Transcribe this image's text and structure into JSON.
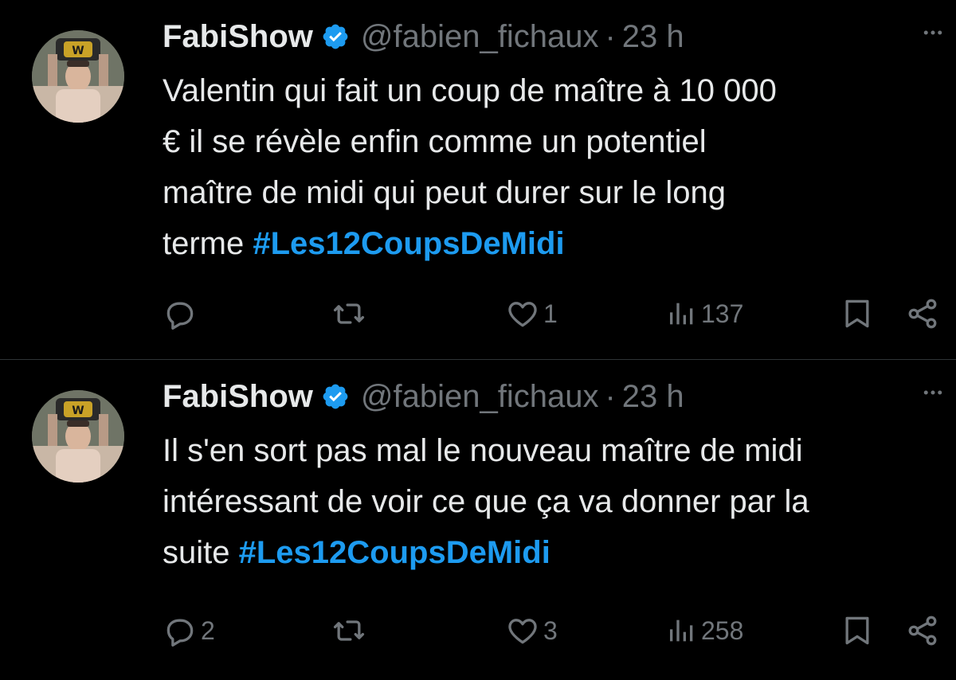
{
  "tweets": [
    {
      "author": {
        "name": "FabiShow",
        "handle": "@fabien_fichaux",
        "separator": "·",
        "time": "23 h",
        "avatar_icon": "avatar-wrestler-icon",
        "verified_icon": "verified-badge-icon"
      },
      "text_plain": "Valentin qui fait un coup de maître à 10 000\n€ il se révèle enfin comme un potentiel\nmaître de midi qui peut durer sur le long\nterme ",
      "hashtag": "#Les12CoupsDeMidi",
      "stats": {
        "replies": "",
        "retweets": "",
        "likes": "1",
        "views": "137"
      }
    },
    {
      "author": {
        "name": "FabiShow",
        "handle": "@fabien_fichaux",
        "separator": "·",
        "time": "23 h",
        "avatar_icon": "avatar-wrestler-icon",
        "verified_icon": "verified-badge-icon"
      },
      "text_plain": "Il s'en sort pas mal le nouveau maître de midi\nintéressant de voir ce que ça va donner par la\nsuite ",
      "hashtag": "#Les12CoupsDeMidi",
      "stats": {
        "replies": "2",
        "retweets": "",
        "likes": "3",
        "views": "258"
      }
    }
  ],
  "colors": {
    "background": "#000000",
    "text": "#e7e9ea",
    "muted": "#71767b",
    "accent": "#1d9bf0",
    "divider": "#2f3336"
  },
  "icons": [
    "reply-icon",
    "retweet-icon",
    "like-icon",
    "views-icon",
    "bookmark-icon",
    "share-icon",
    "more-icon"
  ]
}
